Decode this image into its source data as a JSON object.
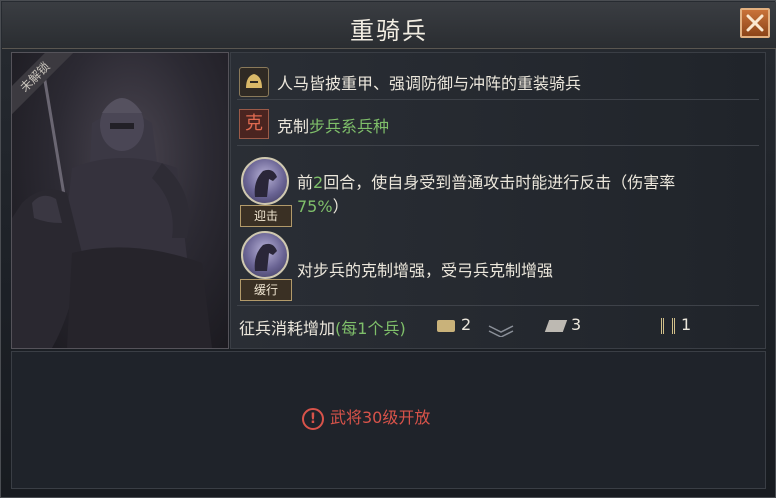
{
  "title": "重骑兵",
  "portrait": {
    "status": "未解锁"
  },
  "summary": "人马皆披重甲、强调防御与冲阵的重装骑兵",
  "counter": {
    "tag": "克",
    "label": "克制",
    "target": "步兵系兵种"
  },
  "skills": [
    {
      "name": "迎击",
      "desc_prefix": "前",
      "desc_num": "2",
      "desc_mid": "回合，使自身受到普通攻击时能进行反击（伤害率",
      "desc_pct": "75%",
      "desc_suffix": "）"
    },
    {
      "name": "缓行",
      "desc": "对步兵的克制增强，受弓兵克制增强"
    }
  ],
  "cost": {
    "label": "征兵消耗增加",
    "note": "(每1个兵)",
    "items": [
      {
        "icon": "wood-icon",
        "value": "2"
      },
      {
        "icon": "stone-icon",
        "value": "3"
      },
      {
        "icon": "grain-icon",
        "value": "1"
      }
    ]
  },
  "unlock_msg": "武将30级开放",
  "colors": {
    "accent": "#c9733a",
    "warning": "#d8534a",
    "green": "#7fbf6a"
  }
}
